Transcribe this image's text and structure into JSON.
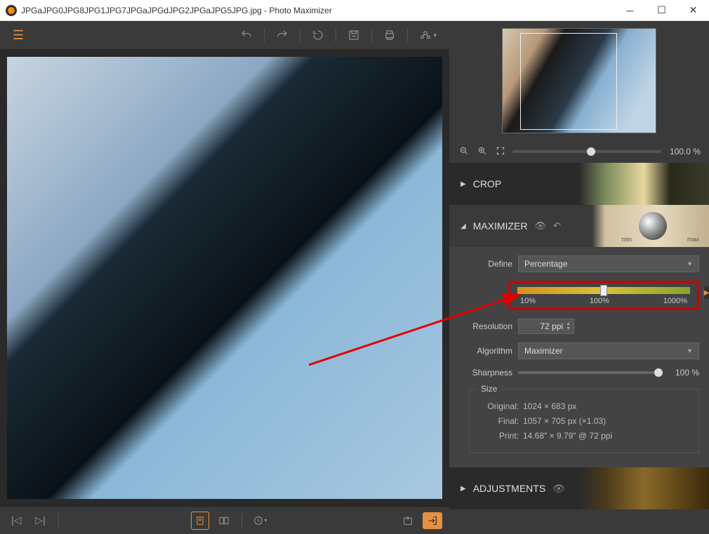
{
  "window": {
    "title": "JPGaJPG0JPG8JPG1JPG7JPGaJPGdJPG2JPGaJPG5JPG.jpg - Photo Maximizer"
  },
  "canvas": {
    "zoom_label": "×1.03"
  },
  "preview": {
    "zoom_percent": "100.0 %"
  },
  "panels": {
    "crop": {
      "title": "CROP"
    },
    "maximizer": {
      "title": "MAXIMIZER",
      "min_label": "min",
      "max_label": "max",
      "define_label": "Define",
      "define_value": "Percentage",
      "percent_value": "103.2 %",
      "tick_10": "10%",
      "tick_100": "100%",
      "tick_1000": "1000%",
      "resolution_label": "Resolution",
      "resolution_value": "72 ppi",
      "algorithm_label": "Algorithm",
      "algorithm_value": "Maximizer",
      "sharpness_label": "Sharpness",
      "sharpness_value": "100 %",
      "size_title": "Size",
      "original_label": "Original:",
      "original_value": "1024 × 683 px",
      "final_label": "Final:",
      "final_value": "1057 × 705 px (×1.03)",
      "print_label": "Print:",
      "print_value": "14.68\" × 9.79\" @ 72 ppi"
    },
    "adjustments": {
      "title": "ADJUSTMENTS"
    }
  }
}
